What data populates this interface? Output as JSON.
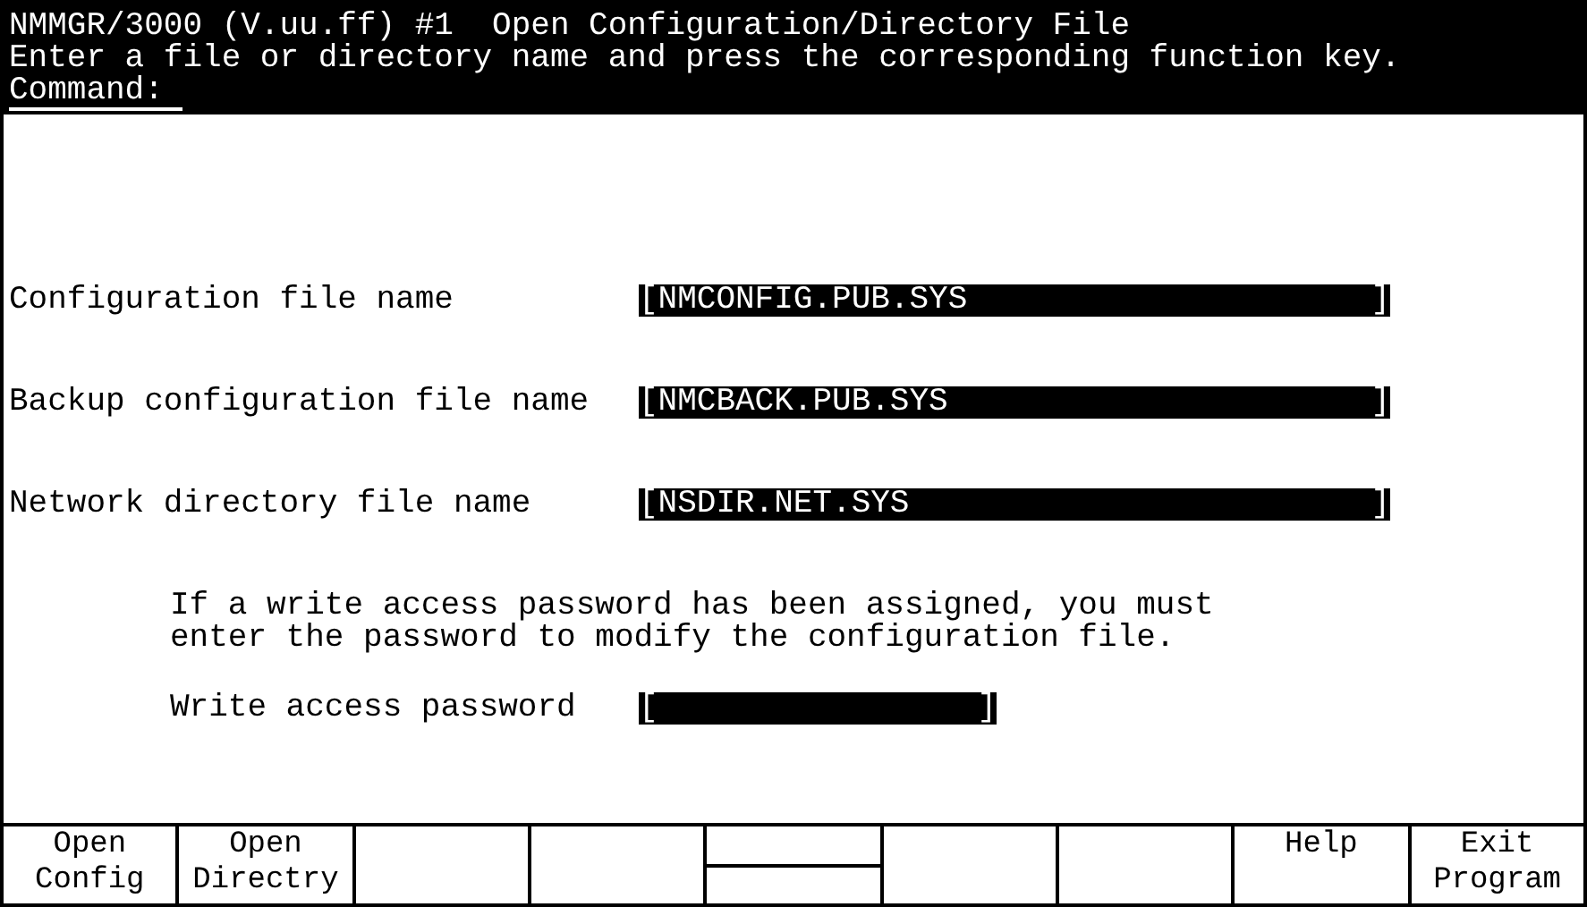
{
  "header": {
    "title": "NMMGR/3000 (V.uu.ff) #1  Open Configuration/Directory File",
    "instruction": "Enter a file or directory name and press the corresponding function key.",
    "command_label": "Command:"
  },
  "fields": [
    {
      "label": "Configuration file name",
      "left_bracket": "[",
      "value": "NMCONFIG.PUB.SYS",
      "right_bracket": "]"
    },
    {
      "label": "Backup configuration file name",
      "left_bracket": "[",
      "value": "NMCBACK.PUB.SYS",
      "right_bracket": "]"
    },
    {
      "label": "Network directory file name",
      "left_bracket": "[",
      "value": "NSDIR.NET.SYS",
      "right_bracket": "]"
    }
  ],
  "note": [
    "If a write access password has been assigned, you must",
    "enter the password to modify the configuration file."
  ],
  "password": {
    "label": "Write access password",
    "left_bracket": "[",
    "right_bracket": "]"
  },
  "function_keys": [
    {
      "kind": "label",
      "lines": [
        "Open",
        "Config"
      ]
    },
    {
      "kind": "label",
      "lines": [
        "Open",
        "Directry"
      ]
    },
    {
      "kind": "blank"
    },
    {
      "kind": "blank"
    },
    {
      "kind": "split"
    },
    {
      "kind": "blank"
    },
    {
      "kind": "blank"
    },
    {
      "kind": "label",
      "lines": [
        "Help"
      ]
    },
    {
      "kind": "label",
      "lines": [
        "Exit",
        "Program"
      ]
    }
  ]
}
